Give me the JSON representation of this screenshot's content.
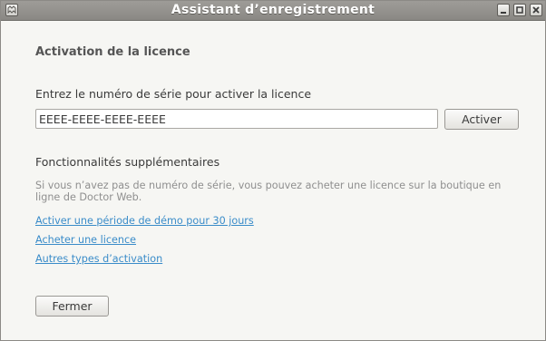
{
  "window": {
    "title": "Assistant d’enregistrement"
  },
  "titlebar_icons": {
    "menu": "window-menu-icon",
    "minimize": "minimize-icon",
    "maximize": "maximize-icon",
    "close": "close-icon"
  },
  "main": {
    "heading": "Activation de la licence",
    "serial_label": "Entrez le numéro de série pour activer la licence",
    "serial_value": "EEEE-EEEE-EEEE-EEEE",
    "activate_label": "Activer",
    "extra_heading": "Fonctionnalités supplémentaires",
    "info_text": "Si vous n’avez pas de numéro de série, vous pouvez acheter une licence sur la boutique en ligne de Doctor Web.",
    "links": {
      "demo": "Activer une période de démo pour 30 jours",
      "buy": "Acheter une licence",
      "other": "Autres types d’activation"
    },
    "close_label": "Fermer"
  },
  "colors": {
    "link": "#3a8cc9",
    "titlebar": "#9a9894",
    "background": "#f6f6f3"
  }
}
